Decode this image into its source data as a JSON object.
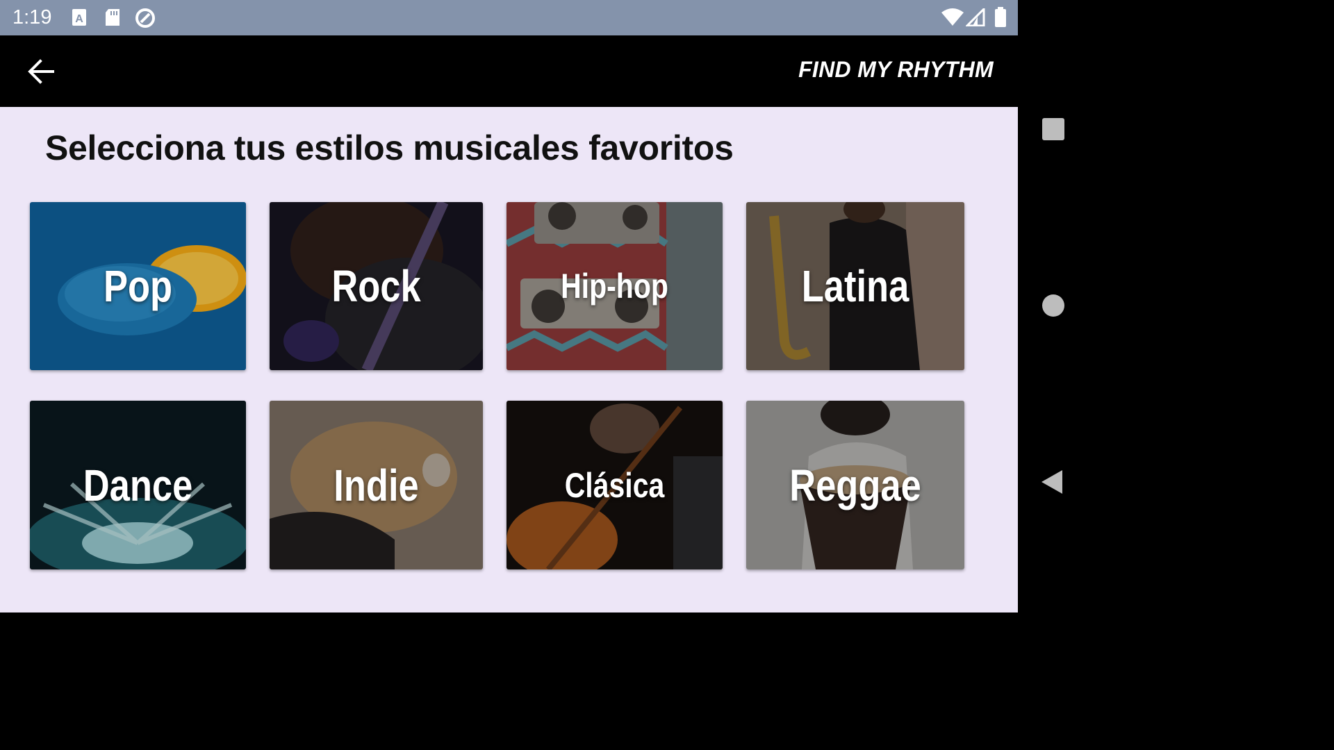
{
  "status_bar": {
    "time": "1:19",
    "icons": [
      "keyboard-a-icon",
      "sd-card-icon",
      "sync-icon",
      "wifi-icon",
      "signal-icon",
      "battery-icon"
    ]
  },
  "app_bar": {
    "back_icon": "arrow-back-icon",
    "title": "FIND MY RHYTHM"
  },
  "main": {
    "heading": "Selecciona tus estilos musicales favoritos",
    "genres": [
      {
        "label": "Pop"
      },
      {
        "label": "Rock"
      },
      {
        "label": "Hip-hop"
      },
      {
        "label": "Latina"
      },
      {
        "label": "Dance"
      },
      {
        "label": "Indie"
      },
      {
        "label": "Clásica"
      },
      {
        "label": "Reggae"
      }
    ]
  },
  "nav_bar": {
    "icons": [
      "recents-square-icon",
      "home-circle-icon",
      "back-triangle-icon"
    ]
  },
  "colors": {
    "status_bar": "#8493ab",
    "app_bar": "#000000",
    "content_bg": "#ede6f7"
  }
}
